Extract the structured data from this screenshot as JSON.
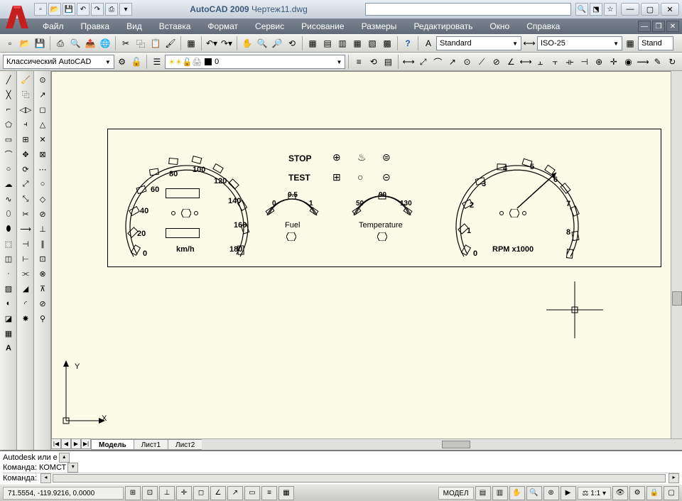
{
  "title_app": "AutoCAD 2009",
  "title_doc": "Чертеж11.dwg",
  "menus": [
    "Файл",
    "Правка",
    "Вид",
    "Вставка",
    "Формат",
    "Сервис",
    "Рисование",
    "Размеры",
    "Редактировать",
    "Окно",
    "Справка"
  ],
  "workspace_combo": "Классический AutoCAD",
  "layer_combo": "0",
  "textstyle_combo": "Standard",
  "dimstyle_combo": "ISO-25",
  "tablestyle_combo": "Stand",
  "tabs": {
    "nav": [
      "|◀",
      "◀",
      "▶",
      "▶|"
    ],
    "items": [
      "Модель",
      "Лист1",
      "Лист2"
    ],
    "active": 0
  },
  "cmdline": {
    "line1": "Autodesk или е",
    "line2_label": "Команда:",
    "line2_val": "КОМСТ",
    "line3_label": "Команда:"
  },
  "status": {
    "coords": "71.5554, -119.9216, 0.0000",
    "model_btn": "МОДЕЛ",
    "scale": "1:1"
  },
  "drawing": {
    "stop": "STOP",
    "test": "TEST",
    "fuel_label": "Fuel",
    "temp_label": "Temperature",
    "rpm_label": "RPM x1000",
    "kmh_label": "km/h",
    "speed_nums": [
      "0",
      "20",
      "40",
      "60",
      "80",
      "100",
      "120",
      "140",
      "160",
      "180"
    ],
    "rpm_nums": [
      "0",
      "1",
      "2",
      "3",
      "4",
      "5",
      "6",
      "7",
      "8"
    ],
    "fuel_nums": [
      "0",
      "0.5",
      "1"
    ],
    "temp_nums": [
      "50",
      "90",
      "130"
    ],
    "axes": {
      "x": "X",
      "y": "Y"
    }
  }
}
